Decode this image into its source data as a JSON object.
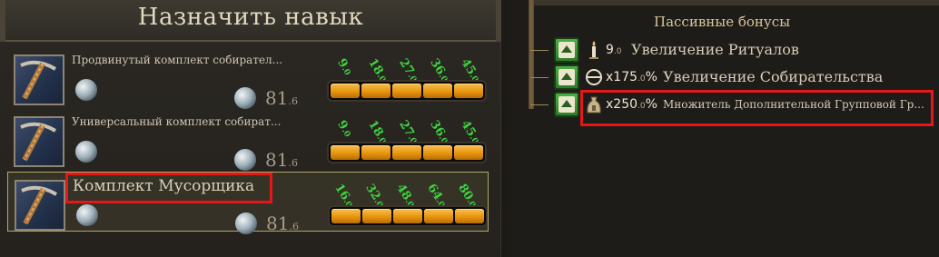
{
  "header": {
    "title": "Назначить навык"
  },
  "skills": [
    {
      "name": "Продвинутый комплект собирател...",
      "cost_int": "81",
      "cost_frac": ".6",
      "thresholds": [
        {
          "int": "9",
          "frac": ".0"
        },
        {
          "int": "18",
          "frac": ".0"
        },
        {
          "int": "27",
          "frac": ".0"
        },
        {
          "int": "36",
          "frac": ".0"
        },
        {
          "int": "45",
          "frac": ".0"
        }
      ],
      "progress_filled_segments": 5
    },
    {
      "name": "Универсальный комплект собират...",
      "cost_int": "81",
      "cost_frac": ".6",
      "thresholds": [
        {
          "int": "9",
          "frac": ".0"
        },
        {
          "int": "18",
          "frac": ".0"
        },
        {
          "int": "27",
          "frac": ".0"
        },
        {
          "int": "36",
          "frac": ".0"
        },
        {
          "int": "45",
          "frac": ".0"
        }
      ],
      "progress_filled_segments": 5
    },
    {
      "name": "Комплект Мусорщика",
      "cost_int": "81",
      "cost_frac": ".6",
      "thresholds": [
        {
          "int": "16",
          "frac": ".0"
        },
        {
          "int": "32",
          "frac": ".0"
        },
        {
          "int": "48",
          "frac": ".0"
        },
        {
          "int": "64",
          "frac": ".0"
        },
        {
          "int": "80",
          "frac": ".0"
        }
      ],
      "progress_filled_segments": 5,
      "selected": true
    }
  ],
  "passive": {
    "title": "Пассивные бонусы",
    "bonuses": [
      {
        "value": "9",
        "value_frac": ".0",
        "value_suffix": "",
        "name": "Увеличение Ритуалов",
        "icon": "candle-icon"
      },
      {
        "value": "x175",
        "value_frac": ".0",
        "value_suffix": "%",
        "name": "Увеличение Собирательства",
        "icon": "pot-icon"
      },
      {
        "value": "x250",
        "value_frac": ".0",
        "value_suffix": "%",
        "name": "Множитель Дополнительной Групповой Гр...",
        "icon": "bag-icon"
      }
    ]
  },
  "colors": {
    "threshold_text": "#3fd13f",
    "progress_fill": "#e7950f",
    "highlight": "#e51717",
    "upgrade_button": "#4caf44"
  }
}
